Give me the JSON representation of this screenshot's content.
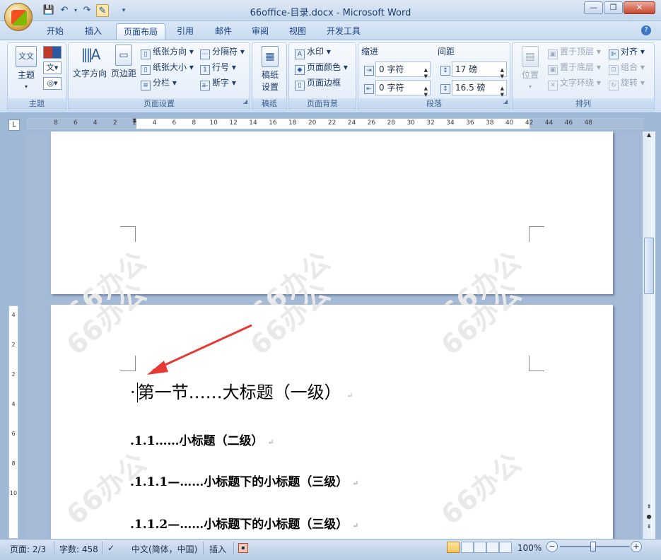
{
  "window": {
    "title": "66office-目录.docx - Microsoft Word",
    "minimize": "—",
    "restore": "❐",
    "close": "✕"
  },
  "tabs": [
    "开始",
    "插入",
    "页面布局",
    "引用",
    "邮件",
    "审阅",
    "视图",
    "开发工具"
  ],
  "active_tab": "页面布局",
  "ribbon": {
    "theme": {
      "button": "主题",
      "icon_text": "文文",
      "group": "主题"
    },
    "page_setup": {
      "group": "页面设置",
      "text_direction": "文字方向",
      "margins": "页边距",
      "orientation": "纸张方向",
      "size": "纸张大小",
      "columns": "分栏",
      "breaks": "分隔符",
      "line_numbers": "行号",
      "hyphenation": "断字"
    },
    "manuscript": {
      "button_line1": "稿纸",
      "button_line2": "设置",
      "group": "稿纸"
    },
    "page_background": {
      "group": "页面背景",
      "watermark": "水印",
      "page_color": "页面颜色",
      "page_borders": "页面边框"
    },
    "paragraph": {
      "group": "段落",
      "indent_label": "缩进",
      "spacing_label": "间距",
      "indent_left": "0 字符",
      "indent_right": "0 字符",
      "spacing_before": "17 磅",
      "spacing_after": "16.5 磅"
    },
    "arrange": {
      "group": "排列",
      "position": "位置",
      "bring_front": "置于顶层",
      "send_back": "置于底层",
      "text_wrap": "文字环绕",
      "align": "对齐",
      "group_btn": "组合",
      "rotate": "旋转"
    }
  },
  "ruler": {
    "corner": "L",
    "h_labels": [
      "8",
      "6",
      "4",
      "2",
      "2",
      "4",
      "6",
      "8",
      "10",
      "12",
      "14",
      "16",
      "18",
      "20",
      "22",
      "24",
      "26",
      "28",
      "30",
      "32",
      "34",
      "36",
      "38",
      "40",
      "42",
      "44",
      "46",
      "48"
    ],
    "v_labels": [
      "4",
      "2",
      "2",
      "4",
      "6",
      "8",
      "10"
    ]
  },
  "document": {
    "heading1": "第一节……大标题（一级）",
    "heading2": "1.1……小标题（二级）",
    "heading3a": "1.1.1—……小标题下的小标题（三级）",
    "heading3b": "1.1.2—……小标题下的小标题（三级）",
    "paragraph_mark": "↵",
    "watermark": "66办公"
  },
  "status": {
    "page": "页面: 2/3",
    "words": "字数: 458",
    "language": "中文(简体，中国)",
    "mode": "插入",
    "zoom": "100%",
    "zoom_out": "−",
    "zoom_in": "+"
  }
}
